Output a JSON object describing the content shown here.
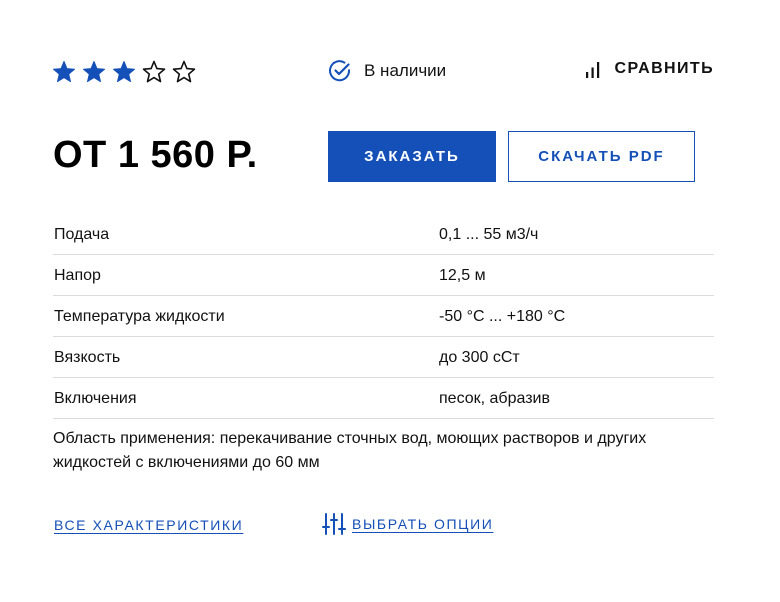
{
  "rating": {
    "value": 3,
    "max": 5,
    "filled_color": "#1450b8",
    "empty_color": "#111111"
  },
  "availability": {
    "icon": "check-circle-icon",
    "label": "В наличии"
  },
  "compare": {
    "icon": "bar-chart-icon",
    "label": "СРАВНИТЬ"
  },
  "price": {
    "label": "ОТ 1 560 Р."
  },
  "actions": {
    "order_label": "ЗАКАЗАТЬ",
    "pdf_label": "СКАЧАТЬ PDF"
  },
  "specs": [
    {
      "name": "Подача",
      "value": "0,1 ... 55 м3/ч"
    },
    {
      "name": "Напор",
      "value": "12,5 м"
    },
    {
      "name": "Температура жидкости",
      "value": "-50 °С ... +180 °С"
    },
    {
      "name": "Вязкость",
      "value": "до 300 сСт"
    },
    {
      "name": "Включения",
      "value": "песок, абразив"
    }
  ],
  "description": "Область применения: перекачивание сточных вод, моющих растворов и других жидкостей с включениями до 60 мм",
  "links": {
    "all_specs": "ВСЕ ХАРАКТЕРИСТИКИ",
    "options_icon": "sliders-icon",
    "options": "ВЫБРАТЬ ОПЦИИ"
  },
  "colors": {
    "accent": "#1450b8",
    "divider": "#dcdcdc",
    "text": "#111111"
  }
}
